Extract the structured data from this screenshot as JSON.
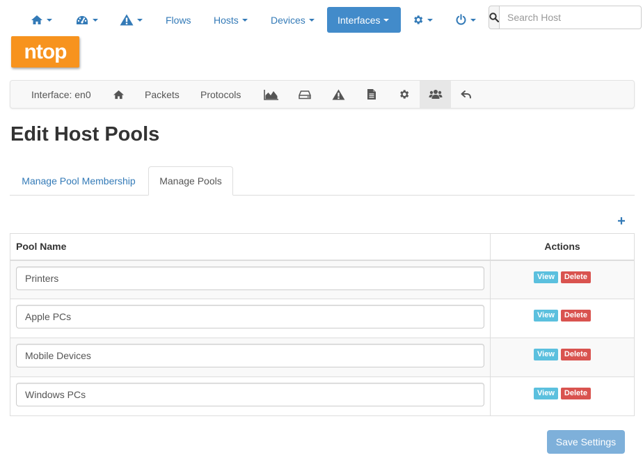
{
  "navbar": {
    "items": [
      {
        "icon": "home-icon",
        "has_caret": true
      },
      {
        "icon": "dashboard-gauge-icon",
        "has_caret": true
      },
      {
        "icon": "warning-icon",
        "has_caret": true
      },
      {
        "label": "Flows"
      },
      {
        "label": "Hosts",
        "has_caret": true
      },
      {
        "label": "Devices",
        "has_caret": true
      },
      {
        "label": "Interfaces",
        "has_caret": true,
        "active": true
      },
      {
        "icon": "gear-icon",
        "has_caret": true
      },
      {
        "icon": "power-icon",
        "has_caret": true
      }
    ],
    "search": {
      "placeholder": "Search Host",
      "value": ""
    },
    "accent_color": "#428bca",
    "link_color": "#337ab7"
  },
  "logo": {
    "text": "ntop",
    "color": "#f7931e"
  },
  "interface_nav": {
    "label": "Interface: en0",
    "items": [
      {
        "icon": "home-icon"
      },
      {
        "label": "Packets"
      },
      {
        "label": "Protocols"
      },
      {
        "icon": "area-chart-icon"
      },
      {
        "icon": "hard-drive-icon"
      },
      {
        "icon": "warning-icon"
      },
      {
        "icon": "file-text-icon"
      },
      {
        "icon": "gear-icon"
      },
      {
        "icon": "users-icon",
        "active": true
      },
      {
        "icon": "back-arrow-icon"
      }
    ]
  },
  "page": {
    "title": "Edit Host Pools"
  },
  "tabs": [
    {
      "label": "Manage Pool Membership",
      "active": false
    },
    {
      "label": "Manage Pools",
      "active": true
    }
  ],
  "table": {
    "columns": [
      "Pool Name",
      "Actions"
    ],
    "rows": [
      {
        "name": "Printers",
        "actions": [
          "View",
          "Delete"
        ]
      },
      {
        "name": "Apple PCs",
        "actions": [
          "View",
          "Delete"
        ]
      },
      {
        "name": "Mobile Devices",
        "actions": [
          "View",
          "Delete"
        ]
      },
      {
        "name": "Windows PCs",
        "actions": [
          "View",
          "Delete"
        ]
      }
    ],
    "view_color": "#5bc0de",
    "delete_color": "#d9534f"
  },
  "footer": {
    "save_label": "Save Settings"
  }
}
